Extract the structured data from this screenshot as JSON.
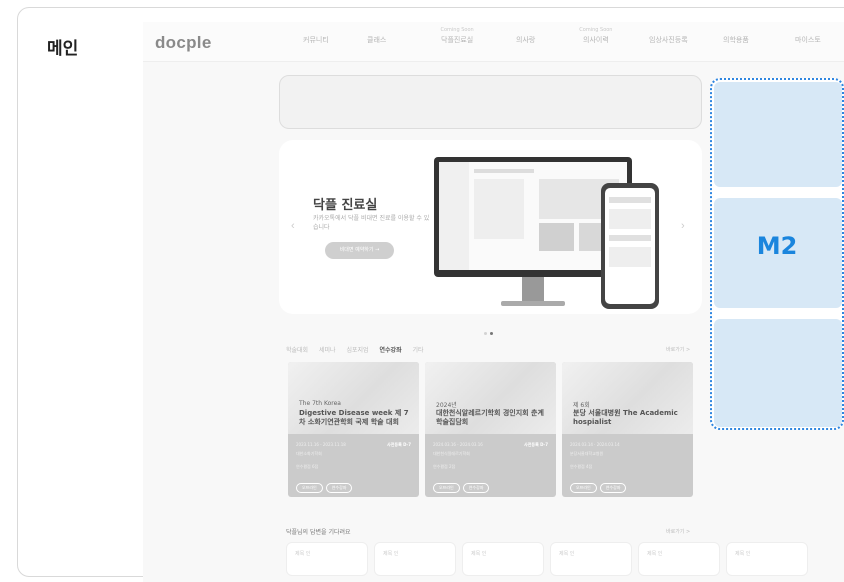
{
  "page_label": "메인",
  "site": {
    "logo": "docple",
    "nav": [
      {
        "label": "커뮤니티"
      },
      {
        "label": "클래스"
      },
      {
        "label": "닥플진료실",
        "tag": "Coming Soon"
      },
      {
        "label": "의사랑"
      },
      {
        "label": "의사이력",
        "tag": "Coming Soon"
      },
      {
        "label": "임상사진등록"
      },
      {
        "label": "의학용품"
      },
      {
        "label": "마이스토"
      }
    ],
    "hero": {
      "title": "닥플 진료실",
      "desc": "카카오톡에서 닥플 비대면 진료를 이용할 수 있습니다",
      "button": "비대면 예약하기 →",
      "prev": "‹",
      "next": "›"
    },
    "categories": {
      "tabs": [
        "학술대회",
        "세미나",
        "심포지엄",
        "연수강좌",
        "기타"
      ],
      "active": "연수강좌",
      "more": "바로가기 >"
    },
    "cards": [
      {
        "sub": "The 7th Korea",
        "title": "Digestive Disease week 제 7차 소화기연관학회 국제 학술 대회",
        "date": "2023.11.16 - 2023.11.18",
        "dday": "사전등록 D-7",
        "org": "대한소화기학회",
        "note": "연수평점 6점",
        "chips": [
          "오프라인",
          "연수강좌"
        ]
      },
      {
        "sub": "2024년",
        "title": "대한천식알레르기학회 경인지회 춘계 학술집담회",
        "date": "2024.03.16 - 2024.03.16",
        "dday": "사전등록 D-7",
        "org": "대한천식알레르기학회",
        "note": "연수평점 2점",
        "chips": [
          "오프라인",
          "연수강좌"
        ]
      },
      {
        "sub": "제 6회",
        "title": "분당 서울대병원 The Academic hospialist",
        "date": "2024.03.14 · 2024.03.14",
        "dday": "",
        "org": "분당서울대학교병원",
        "note": "연수평점 4점",
        "chips": [
          "오프라인",
          "연수강좌"
        ]
      }
    ],
    "qna": {
      "title": "닥플님의 답변을 기다려요",
      "more": "바로가기 >",
      "cards": [
        "제목 인",
        "제목 인",
        "제목 인",
        "제목 인",
        "제목 인",
        "제목 인"
      ]
    }
  },
  "m2": {
    "label": "M2"
  },
  "colors": {
    "m2_border": "#2f86e0",
    "m2_fill": "#d7e8f6",
    "m2_text": "#1a85dd"
  }
}
